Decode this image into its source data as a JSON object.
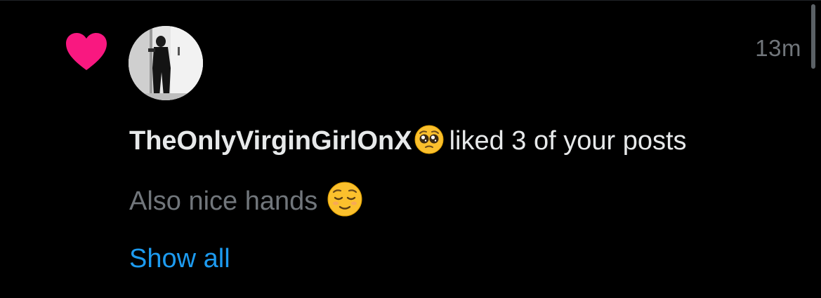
{
  "notification": {
    "icon": "heart-icon",
    "icon_color": "#f91880",
    "avatar": "profile-photo",
    "timestamp": "13m",
    "username": "TheOnlyVirginGirlOnX",
    "username_emoji": "pleading-face-emoji",
    "action_text": "liked 3 of your posts",
    "preview_text": "Also nice hands",
    "preview_emoji": "relieved-face-emoji",
    "show_all_label": "Show all",
    "link_color": "#1d9bf0"
  }
}
